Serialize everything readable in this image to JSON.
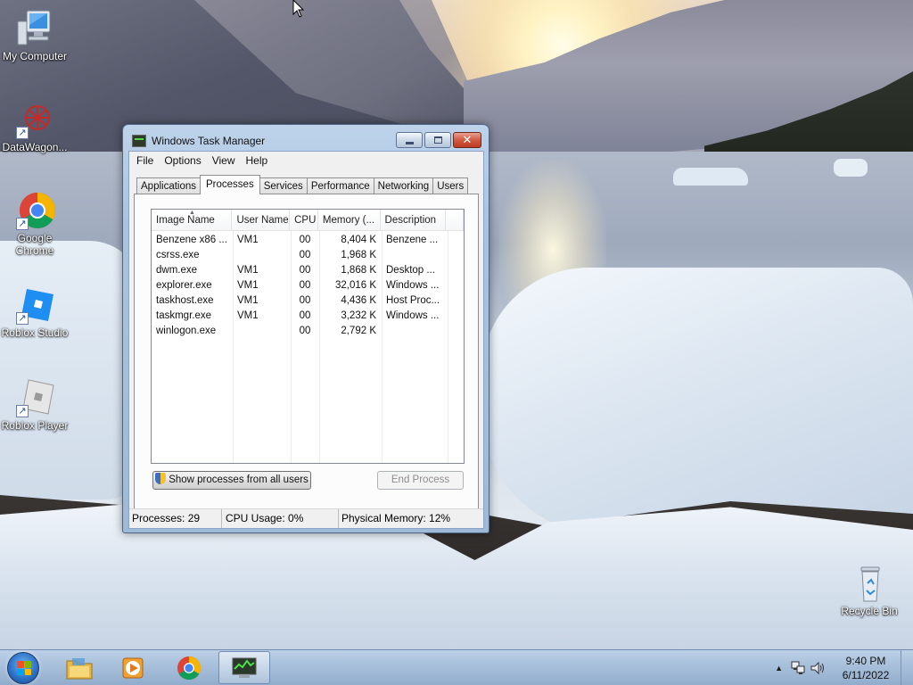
{
  "desktop_icons": [
    {
      "label": "My Computer",
      "icon": "computer-icon"
    },
    {
      "label": "DataWagon...",
      "icon": "datawagon-icon"
    },
    {
      "label": "Google Chrome",
      "icon": "chrome-icon"
    },
    {
      "label": "Roblox Studio",
      "icon": "roblox-studio-icon"
    },
    {
      "label": "Roblox Player",
      "icon": "roblox-player-icon"
    },
    {
      "label": "Recycle Bin",
      "icon": "recycle-bin-icon"
    }
  ],
  "task_manager": {
    "title": "Windows Task Manager",
    "menu": [
      "File",
      "Options",
      "View",
      "Help"
    ],
    "tabs": [
      "Applications",
      "Processes",
      "Services",
      "Performance",
      "Networking",
      "Users"
    ],
    "active_tab": "Processes",
    "columns": [
      "Image Name",
      "User Name",
      "CPU",
      "Memory (...",
      "Description"
    ],
    "processes": [
      {
        "name": "Benzene x86 ...",
        "user": "VM1",
        "cpu": "00",
        "memory": "8,404 K",
        "description": "Benzene ..."
      },
      {
        "name": "csrss.exe",
        "user": "",
        "cpu": "00",
        "memory": "1,968 K",
        "description": ""
      },
      {
        "name": "dwm.exe",
        "user": "VM1",
        "cpu": "00",
        "memory": "1,868 K",
        "description": "Desktop ..."
      },
      {
        "name": "explorer.exe",
        "user": "VM1",
        "cpu": "00",
        "memory": "32,016 K",
        "description": "Windows ..."
      },
      {
        "name": "taskhost.exe",
        "user": "VM1",
        "cpu": "00",
        "memory": "4,436 K",
        "description": "Host Proc..."
      },
      {
        "name": "taskmgr.exe",
        "user": "VM1",
        "cpu": "00",
        "memory": "3,232 K",
        "description": "Windows ..."
      },
      {
        "name": "winlogon.exe",
        "user": "",
        "cpu": "00",
        "memory": "2,792 K",
        "description": ""
      }
    ],
    "show_all_button": "Show processes from all users",
    "end_process_button": "End Process",
    "status": {
      "processes": "Processes: 29",
      "cpu": "CPU Usage: 0%",
      "memory": "Physical Memory: 12%"
    }
  },
  "taskbar": {
    "pinned": [
      "start-orb",
      "explorer",
      "media-player",
      "chrome",
      "task-manager"
    ],
    "time": "9:40 PM",
    "date": "6/11/2022"
  },
  "colors": {
    "window_frame": "#a9c3e0",
    "taskbar": "#a0bad7",
    "close_button": "#c03a22"
  }
}
